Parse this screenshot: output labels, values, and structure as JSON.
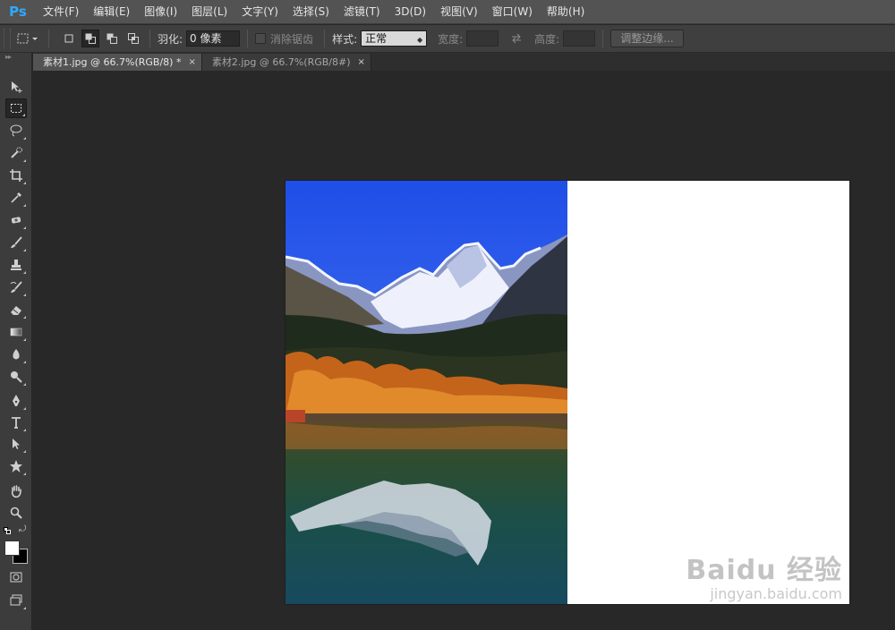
{
  "app": {
    "logo": "Ps"
  },
  "menu": [
    {
      "label": "文件(F)"
    },
    {
      "label": "编辑(E)"
    },
    {
      "label": "图像(I)"
    },
    {
      "label": "图层(L)"
    },
    {
      "label": "文字(Y)"
    },
    {
      "label": "选择(S)"
    },
    {
      "label": "滤镜(T)"
    },
    {
      "label": "3D(D)"
    },
    {
      "label": "视图(V)"
    },
    {
      "label": "窗口(W)"
    },
    {
      "label": "帮助(H)"
    }
  ],
  "options": {
    "feather_label": "羽化:",
    "feather_value": "0 像素",
    "antialias_label": "消除锯齿",
    "style_label": "样式:",
    "style_value": "正常",
    "width_label": "宽度:",
    "height_label": "高度:",
    "refine_button": "调整边缘..."
  },
  "tabs": [
    {
      "label": "素材1.jpg @ 66.7%(RGB/8) *",
      "close": "×",
      "active": true
    },
    {
      "label": "素材2.jpg @ 66.7%(RGB/8#)",
      "close": "×",
      "active": false
    }
  ],
  "watermark": {
    "main": "Baidu 经验",
    "sub": "jingyan.baidu.com"
  },
  "colors": {
    "accent": "#31a8ff",
    "foreground_swatch": "#ffffff",
    "background_swatch": "#000000"
  }
}
